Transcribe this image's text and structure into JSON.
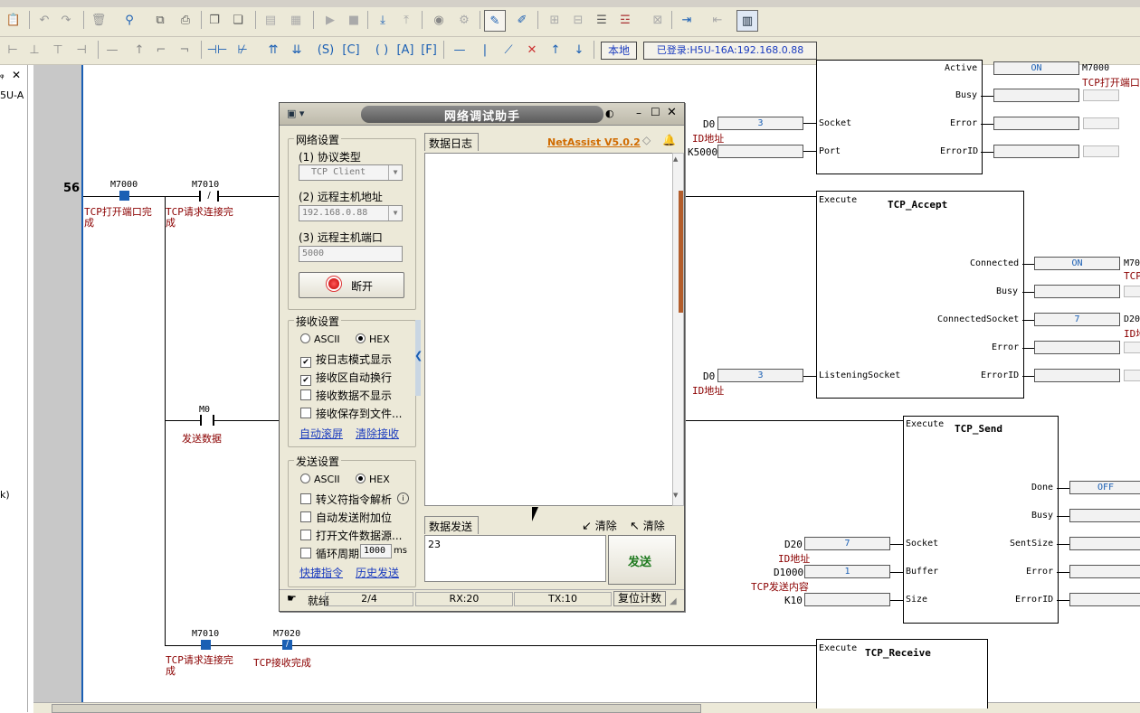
{
  "toolbar": {
    "local_button": "本地",
    "login_status": "已登录:H5U-16A:192.168.0.88"
  },
  "left_panel": {
    "tab_label": "5U-A",
    "close": "✕",
    "pin": "ᵩ",
    "side_text": "k)"
  },
  "ladder": {
    "rung_number": "56",
    "contacts": [
      {
        "addr": "M7000",
        "comment": "TCP打开端口完成"
      },
      {
        "addr": "M7010",
        "comment": "TCP请求连接完成"
      },
      {
        "addr": "M0",
        "comment": "发送数据"
      },
      {
        "addr": "M7010",
        "comment": "TCP请求连接完成"
      },
      {
        "addr": "M7020",
        "comment": "TCP接收完成"
      }
    ],
    "block_top": {
      "inputs": [
        {
          "pin": "Socket",
          "operand": "D0",
          "value": "3",
          "comment": "ID地址"
        },
        {
          "pin": "Port",
          "operand": "K5000",
          "value": ""
        }
      ],
      "outputs": [
        {
          "pin": "Active",
          "value": "ON",
          "right": "M7000",
          "right_comment": "TCP打开端口"
        },
        {
          "pin": "Busy",
          "value": ""
        },
        {
          "pin": "Error",
          "value": ""
        },
        {
          "pin": "ErrorID",
          "value": ""
        }
      ]
    },
    "block_accept": {
      "execute": "Execute",
      "title": "TCP_Accept",
      "inputs": [
        {
          "pin": "ListeningSocket",
          "operand": "D0",
          "value": "3",
          "comment": "ID地址"
        }
      ],
      "outputs": [
        {
          "pin": "Connected",
          "value": "ON",
          "right": "M70",
          "right_comment": "TCP"
        },
        {
          "pin": "Busy",
          "value": ""
        },
        {
          "pin": "ConnectedSocket",
          "value": "7",
          "right": "D20",
          "right_comment": "ID地"
        },
        {
          "pin": "Error",
          "value": ""
        },
        {
          "pin": "ErrorID",
          "value": ""
        }
      ]
    },
    "block_send": {
      "execute": "Execute",
      "title": "TCP_Send",
      "inputs": [
        {
          "pin": "Socket",
          "operand": "D20",
          "value": "7",
          "comment": "ID地址"
        },
        {
          "pin": "Buffer",
          "operand": "D1000",
          "value": "1",
          "comment": "TCP发送内容"
        },
        {
          "pin": "Size",
          "operand": "K10",
          "value": ""
        }
      ],
      "outputs": [
        {
          "pin": "Done",
          "value": "OFF"
        },
        {
          "pin": "Busy",
          "value": ""
        },
        {
          "pin": "SentSize",
          "value": ""
        },
        {
          "pin": "Error",
          "value": ""
        },
        {
          "pin": "ErrorID",
          "value": ""
        }
      ]
    },
    "block_receive": {
      "execute": "Execute",
      "title": "TCP_Receive"
    }
  },
  "netassist": {
    "title": "网络调试助手",
    "brand": "NetAssist V5.0.2",
    "net_settings": {
      "group": "网络设置",
      "protocol_label": "(1) 协议类型",
      "protocol_value": "TCP Client",
      "host_label": "(2) 远程主机地址",
      "host_value": "192.168.0.88",
      "port_label": "(3) 远程主机端口",
      "port_value": "5000",
      "disconnect": "断开"
    },
    "recv_settings": {
      "group": "接收设置",
      "ascii": "ASCII",
      "hex": "HEX",
      "opts": [
        "按日志模式显示",
        "接收区自动换行",
        "接收数据不显示",
        "接收保存到文件..."
      ],
      "checked": [
        true,
        true,
        false,
        false
      ],
      "auto_scroll": "自动滚屏",
      "clear_recv": "清除接收"
    },
    "send_settings": {
      "group": "发送设置",
      "ascii": "ASCII",
      "hex": "HEX",
      "opts": [
        "转义符指令解析",
        "自动发送附加位",
        "打开文件数据源...",
        "循环周期"
      ],
      "cycle_value": "1000",
      "cycle_unit": "ms",
      "shortcut": "快捷指令",
      "history": "历史发送"
    },
    "log_tab": "数据日志",
    "send_tab": "数据发送",
    "clear1": "清除",
    "clear2": "清除",
    "send_text": "23",
    "send_button": "发送",
    "status": {
      "ready": "就绪",
      "count": "2/4",
      "rx": "RX:20",
      "tx": "TX:10",
      "reset": "复位计数"
    }
  }
}
